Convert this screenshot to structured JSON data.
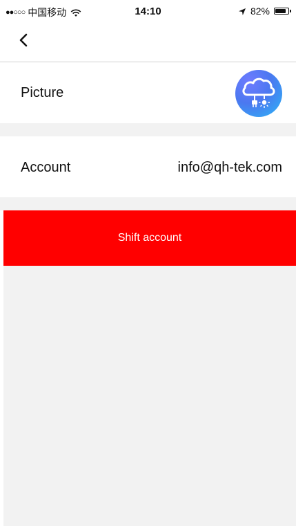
{
  "status_bar": {
    "signal": "●●○○○",
    "carrier": "中国移动",
    "time": "14:10",
    "battery_percent_text": "82%",
    "battery_level": 0.82
  },
  "nav": {
    "back_icon": "chevron-left-icon"
  },
  "profile": {
    "picture_label": "Picture",
    "avatar_icon": "cloud-plug-sun-icon",
    "account_label": "Account",
    "account_value": "info@qh-tek.com"
  },
  "actions": {
    "shift_account_label": "Shift account"
  },
  "colors": {
    "danger": "#ff0000",
    "background_gray": "#f2f2f2",
    "avatar_blue": "#4b78f0"
  }
}
